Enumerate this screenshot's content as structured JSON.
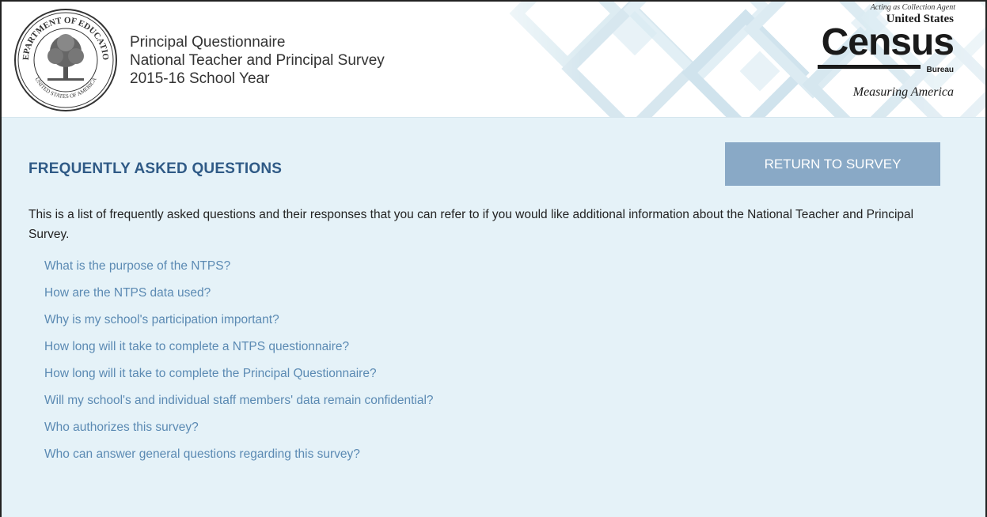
{
  "header": {
    "title_lines": [
      "Principal Questionnaire",
      "National Teacher and Principal Survey",
      "2015-16 School Year"
    ],
    "seal": {
      "outer_text": "DEPARTMENT OF EDUCATION",
      "bottom_text": "UNITED STATES OF AMERICA"
    },
    "census_logo": {
      "agent": "Acting as Collection Agent",
      "united_states": "United States",
      "census": "Census",
      "bureau": "Bureau",
      "tagline": "Measuring America"
    }
  },
  "main": {
    "heading": "FREQUENTLY ASKED QUESTIONS",
    "return_button": "RETURN TO SURVEY",
    "intro": "This is a list of frequently asked questions and their responses that you can refer to if you would like additional information about the National Teacher and Principal Survey.",
    "questions": [
      "What is the purpose of the NTPS?",
      "How are the NTPS data used?",
      "Why is my school's participation important?",
      "How long will it take to complete a NTPS questionnaire?",
      "How long will it take to complete the Principal Questionnaire?",
      "Will my school's and individual staff members' data remain confidential?",
      "Who authorizes this survey?",
      "Who can answer general questions regarding this survey?"
    ]
  },
  "colors": {
    "heading": "#2f5a86",
    "link": "#5b8ab3",
    "button": "#89a9c6",
    "content_bg": "#e5f2f8"
  }
}
